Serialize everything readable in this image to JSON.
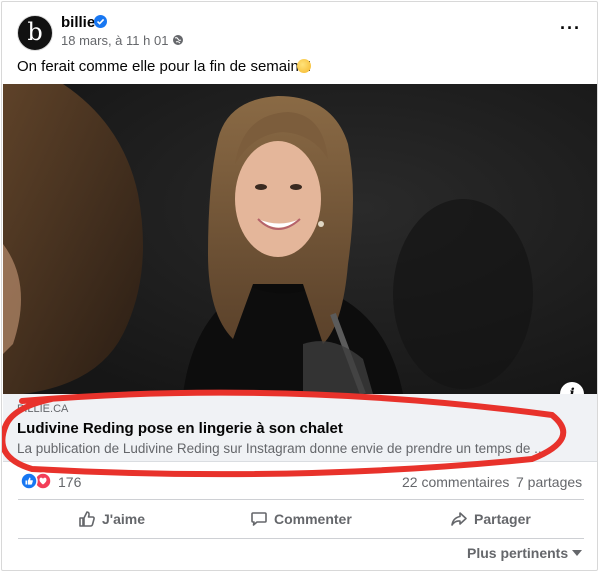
{
  "post": {
    "author": "billie",
    "avatar_letter": "b",
    "timestamp": "18 mars, à 11 h 01 ·",
    "text": "On ferait comme elle pour la fin de semaine!",
    "emoji_icon": "sun-emoji-icon"
  },
  "link_preview": {
    "domain": "BILLIE.CA",
    "title": "Ludivine Reding pose en lingerie à son chalet",
    "description": "La publication de Ludivine Reding sur Instagram donne envie de prendre un temps de ..."
  },
  "stats": {
    "reactions": "176",
    "comments": "22 commentaires",
    "shares": "7 partages"
  },
  "actions": {
    "like": "J'aime",
    "comment": "Commenter",
    "share": "Partager"
  },
  "comments_sort": {
    "label": "Plus pertinents"
  },
  "colors": {
    "accent": "#1877f2",
    "annotation": "#e8322b",
    "secondary_text": "#65676b"
  }
}
